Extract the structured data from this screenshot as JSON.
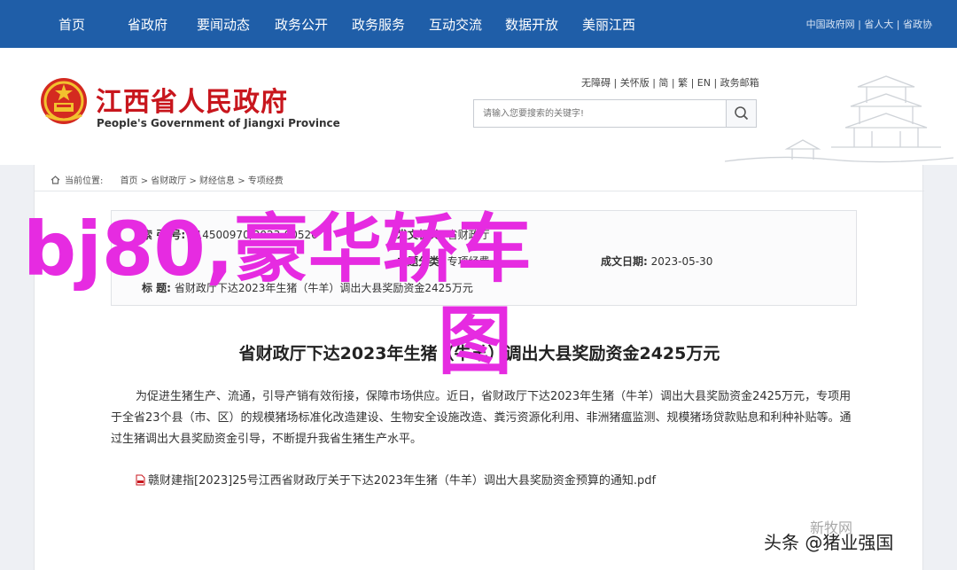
{
  "nav": {
    "items": [
      "首页",
      "省政府",
      "要闻动态",
      "政务公开",
      "政务服务",
      "互动交流",
      "数据开放",
      "美丽江西"
    ],
    "links": "中国政府网 | 省人大 | 省政协"
  },
  "header": {
    "title": "江西省人民政府",
    "subtitle": "People's Government of Jiangxi Province",
    "access_links": "无障碍 | 关怀版 | 简 | 繁 | EN | 政务邮箱",
    "search_placeholder": "请输入您要搜索的关键字!",
    "accent": "#c8161d",
    "nav_color": "#1f5ea8"
  },
  "breadcrumb": {
    "label": "当前位置:",
    "path": "首页 > 省财政厅 > 财经信息 > 专项经费"
  },
  "meta": {
    "index_label": "索 引 号:",
    "index_value": "014500970/2023-00526",
    "issuer_label": "发文机关:",
    "issuer_value": "省财政厅",
    "category_label": "主题分类:",
    "category_value": "专项经费",
    "date_label": "成文日期:",
    "date_value": "2023-05-30",
    "title_label": "标    题:",
    "title_value": "省财政厅下达2023年生猪（牛羊）调出大县奖励资金2425万元"
  },
  "article": {
    "title": "省财政厅下达2023年生猪（牛羊）调出大县奖励资金2425万元",
    "body": "为促进生猪生产、流通，引导产销有效衔接，保障市场供应。近日，省财政厅下达2023年生猪（牛羊）调出大县奖励资金2425万元，专项用于全省23个县（市、区）的规模猪场标准化改造建设、生物安全设施改造、粪污资源化利用、非洲猪瘟监测、规模猪场贷款贴息和利种补贴等。通过生猪调出大县奖励资金引导，不断提升我省生猪生产水平。",
    "attachment": "赣财建指[2023]25号江西省财政厅关于下达2023年生猪（牛羊）调出大县奖励资金预算的通知.pdf"
  },
  "overlay": {
    "line1": "bj80,豪华轿车",
    "line2": "图",
    "color": "#e62be1"
  },
  "watermark": {
    "logo": "新牧网",
    "credit": "头条 @猪业强国"
  }
}
